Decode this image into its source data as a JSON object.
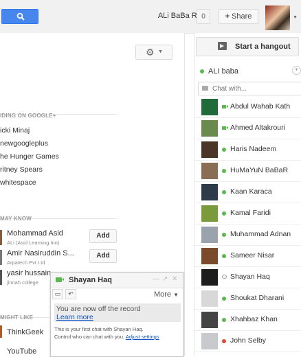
{
  "topbar": {
    "username": "ALi BaBa RKR",
    "notifications": "0",
    "share_plus": "+",
    "share_label": "Share"
  },
  "main": {
    "trending_heading": "IDING ON GOOGLE+",
    "trending": [
      "icki Minaj",
      "newgoogleplus",
      "he Hunger Games",
      "ritney Spears",
      "whitespace"
    ],
    "people_heading": "MAY KNOW",
    "people": [
      {
        "name": "Mohammad Asid",
        "sub": "ALi (Asid Learning Inn)",
        "add": "Add"
      },
      {
        "name": "Amir Nasiruddin S...",
        "sub": "Arpatech Pvt Ltd",
        "add": "Add"
      },
      {
        "name": "yasir hussain",
        "sub": "jinnah college",
        "add": ""
      }
    ],
    "like_heading": "MIGHT LIKE",
    "likes": [
      "ThinkGeek",
      "YouTube"
    ]
  },
  "chat_window": {
    "title": "Shayan Haq",
    "more": "More",
    "off_record": "You are now off the record",
    "learn_more": "Learn more",
    "info_line1": "This is your first chat with Shayan Haq.",
    "info_line2_prefix": "Control who can chat with you.",
    "adjust_settings": "Adjust settings"
  },
  "sidebar": {
    "hangout_label": "Start a hangout",
    "me_name": "ALI baba",
    "search_placeholder": "Chat with...",
    "contacts": [
      {
        "name": "Abdul Wahab Kath",
        "status": "video",
        "color": "#1f6b3a"
      },
      {
        "name": "Ahmed Altakrouri",
        "status": "video",
        "color": "#6a8a4e"
      },
      {
        "name": "Haris Nadeem",
        "status": "dot",
        "color": "#4a3527"
      },
      {
        "name": "HuMaYuN BaBaR",
        "status": "dot",
        "color": "#8a6d55"
      },
      {
        "name": "Kaan Karaca",
        "status": "dot",
        "color": "#2e3b48"
      },
      {
        "name": "Kamal Faridi",
        "status": "dot",
        "color": "#7a9b3c"
      },
      {
        "name": "Muhammad Adnan",
        "status": "dot",
        "color": "#9aa3ad"
      },
      {
        "name": "Sameer Nisar",
        "status": "dot",
        "color": "#7b4a2a"
      },
      {
        "name": "Shayan Haq",
        "status": "bubble",
        "color": "#1d1d1d"
      },
      {
        "name": "Shoukat Dharani",
        "status": "dot",
        "color": "#d8d8d8"
      },
      {
        "name": "Xhahbaz Khan",
        "status": "dot",
        "color": "#444444"
      },
      {
        "name": "John Selby",
        "status": "red",
        "color": "#c7c9cc"
      }
    ]
  }
}
